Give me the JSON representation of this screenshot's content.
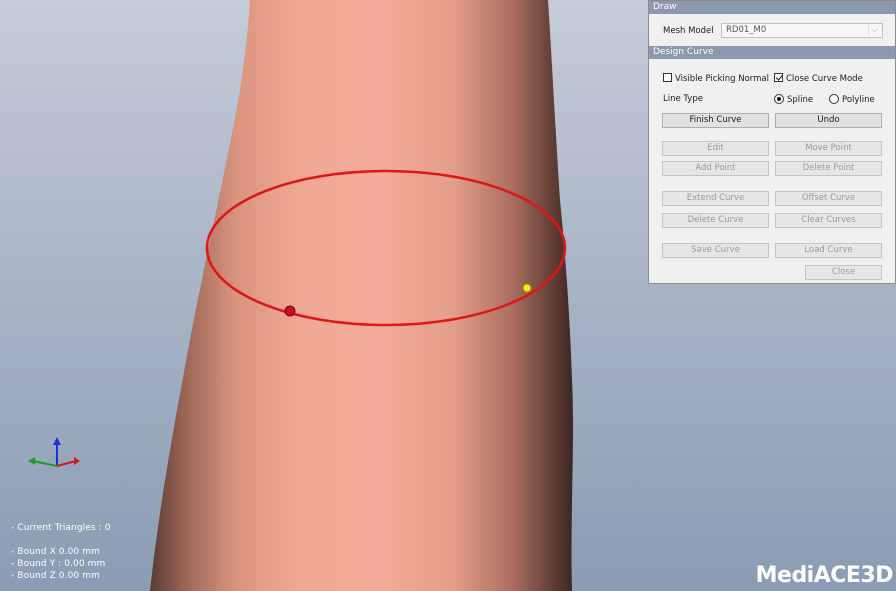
{
  "viewport": {
    "stats": {
      "triangles": "- Current Triangles : 0",
      "bound_x": "- Bound X   0.00 mm",
      "bound_y": "- Bound Y : 0.00 mm",
      "bound_z": "- Bound Z   0.00 mm"
    },
    "logo": "MediACE3D",
    "colors": {
      "skin": "#eea694",
      "curve": "#e01616",
      "point_start": "#d4101a",
      "point_end": "#f3e81a"
    }
  },
  "draw_panel": {
    "title": "Draw",
    "mesh_model_label": "Mesh Model",
    "mesh_model_value": "RD01_M0",
    "section_title": "Design Curve",
    "visible_picking_normal": {
      "label": "Visible Picking Normal",
      "checked": false
    },
    "close_curve_mode": {
      "label": "Close Curve Mode",
      "checked": true
    },
    "line_type_label": "Line Type",
    "line_type_options": {
      "spline": "Spline",
      "polyline": "Polyline",
      "selected": "Spline"
    },
    "buttons": {
      "finish_curve": "Finish Curve",
      "undo": "Undo",
      "edit": "Edit",
      "move_point": "Move Point",
      "add_point": "Add Point",
      "delete_point": "Delete Point",
      "extend_curve": "Extend Curve",
      "offset_curve": "Offset Curve",
      "delete_curve": "Delete Curve",
      "clear_curves": "Clear Curves",
      "save_curve": "Save Curve",
      "load_curve": "Load Curve",
      "close": "Close"
    }
  }
}
